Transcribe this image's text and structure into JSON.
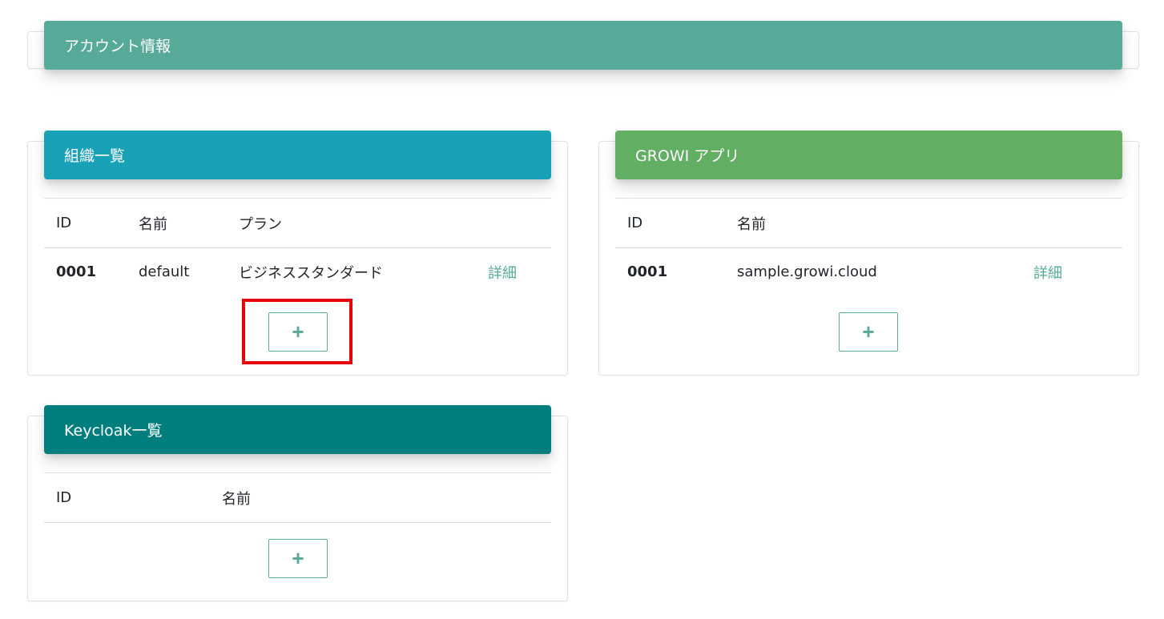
{
  "account": {
    "title": "アカウント情報"
  },
  "organizations": {
    "title": "組織一覧",
    "columns": [
      "ID",
      "名前",
      "プラン"
    ],
    "rows": [
      {
        "id": "0001",
        "name": "default",
        "plan": "ビジネススタンダード",
        "action": "詳細"
      }
    ],
    "add_label": "+"
  },
  "growi_apps": {
    "title": "GROWI アプリ",
    "columns": [
      "ID",
      "名前"
    ],
    "rows": [
      {
        "id": "0001",
        "name": "sample.growi.cloud",
        "action": "詳細"
      }
    ],
    "add_label": "+"
  },
  "keycloak": {
    "title": "Keycloak一覧",
    "columns": [
      "ID",
      "名前"
    ],
    "rows": [],
    "add_label": "+"
  },
  "colors": {
    "account_header": "#57a99a",
    "org_header": "#19a1b8",
    "growi_header": "#62ae63",
    "keycloak_header": "#007e7e",
    "accent": "#57a99a",
    "highlight_box": "#e8000a"
  }
}
